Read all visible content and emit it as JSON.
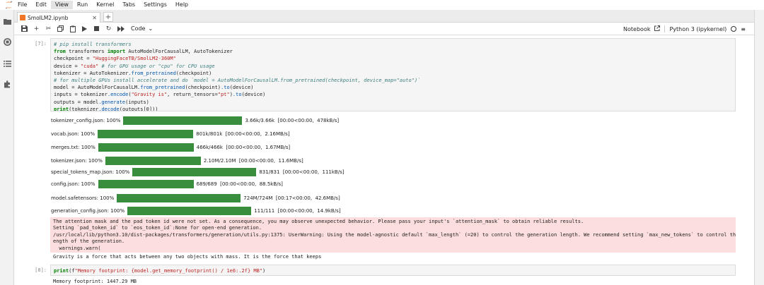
{
  "menu": [
    "File",
    "Edit",
    "View",
    "Run",
    "Kernel",
    "Tabs",
    "Settings",
    "Help"
  ],
  "tab": {
    "title": "SmolLM2.ipynb",
    "add_symbol": "+"
  },
  "toolbar": {
    "cell_type": "Code",
    "notebook_label": "Notebook",
    "kernel_name": "Python 3 (ipykernel)"
  },
  "cell1": {
    "prompt": "[7]:",
    "lines": [
      "# pip install transformers",
      "from transformers import AutoModelForCausalLM, AutoTokenizer",
      "checkpoint = \"HuggingFaceTB/SmolLM2-360M\"",
      "device = \"cuda\" # for GPU usage or \"cpu\" for CPU usage",
      "tokenizer = AutoTokenizer.from_pretrained(checkpoint)",
      "# for multiple GPUs install accelerate and do `model = AutoModelForCausalLM.from_pretrained(checkpoint, device_map=\"auto\")`",
      "model = AutoModelForCausalLM.from_pretrained(checkpoint).to(device)",
      "inputs = tokenizer.encode(\"Gravity is\", return_tensors=\"pt\").to(device)",
      "outputs = model.generate(inputs)",
      "print(tokenizer.decode(outputs[0]))"
    ]
  },
  "downloads": [
    {
      "label": "tokenizer_config.json: 100%",
      "progress": 1.0,
      "stats": "3.66k/3.66k  [00:00<00:00,  478kB/s]"
    },
    {
      "label": "vocab.json: 100%",
      "progress": 1.0,
      "stats": "801k/801k  [00:00<00:00,  2.16MB/s]"
    },
    {
      "label": "merges.txt: 100%",
      "progress": 1.0,
      "stats": "466k/466k  [00:00<00:00,  1.67MB/s]"
    },
    {
      "label": "tokenizer.json: 100%",
      "progress": 1.0,
      "stats": "2.10M/2.10M  [00:00<00:00,  11.6MB/s]"
    },
    {
      "label": "special_tokens_map.json: 100%",
      "progress": 1.0,
      "stats": "831/831  [00:00<00:00,  111kB/s]"
    },
    {
      "label": "config.json: 100%",
      "progress": 1.0,
      "stats": "689/689  [00:00<00:00,  88.5kB/s]"
    },
    {
      "label": "model.safetensors: 100%",
      "progress": 1.0,
      "stats": "724M/724M  [00:17<00:00,  42.6MB/s]"
    },
    {
      "label": "generation_config.json: 100%",
      "progress": 1.0,
      "stats": "111/111  [00:00<00:00,  14.9kB/s]"
    }
  ],
  "stderr_lines": [
    "The attention mask and the pad token id were not set. As a consequence, you may observe unexpected behavior. Please pass your input's `attention_mask` to obtain reliable results.",
    "Setting `pad_token_id` to `eos_token_id`:None for open-end generation.",
    "/usr/local/lib/python3.10/dist-packages/transformers/generation/utils.py:1375: UserWarning: Using the model-agnostic default `max_length` (=20) to control the generation length. We recommend setting `max_new_tokens` to control the maximum l",
    "ength of the generation.",
    "  warnings.warn("
  ],
  "output1": "Gravity is a force that acts between any two objects with mass. It is the force that keeps",
  "cell2": {
    "prompt": "[8]:",
    "code": "print(f\"Memory footprint: {model.get_memory_footprint() / 1e6:.2f} MB\")",
    "output": "Memory footprint: 1447.29 MB"
  },
  "colors": {
    "progress": "#388e3c",
    "stderr_bg": "#fddede",
    "accent": "#f37626"
  }
}
